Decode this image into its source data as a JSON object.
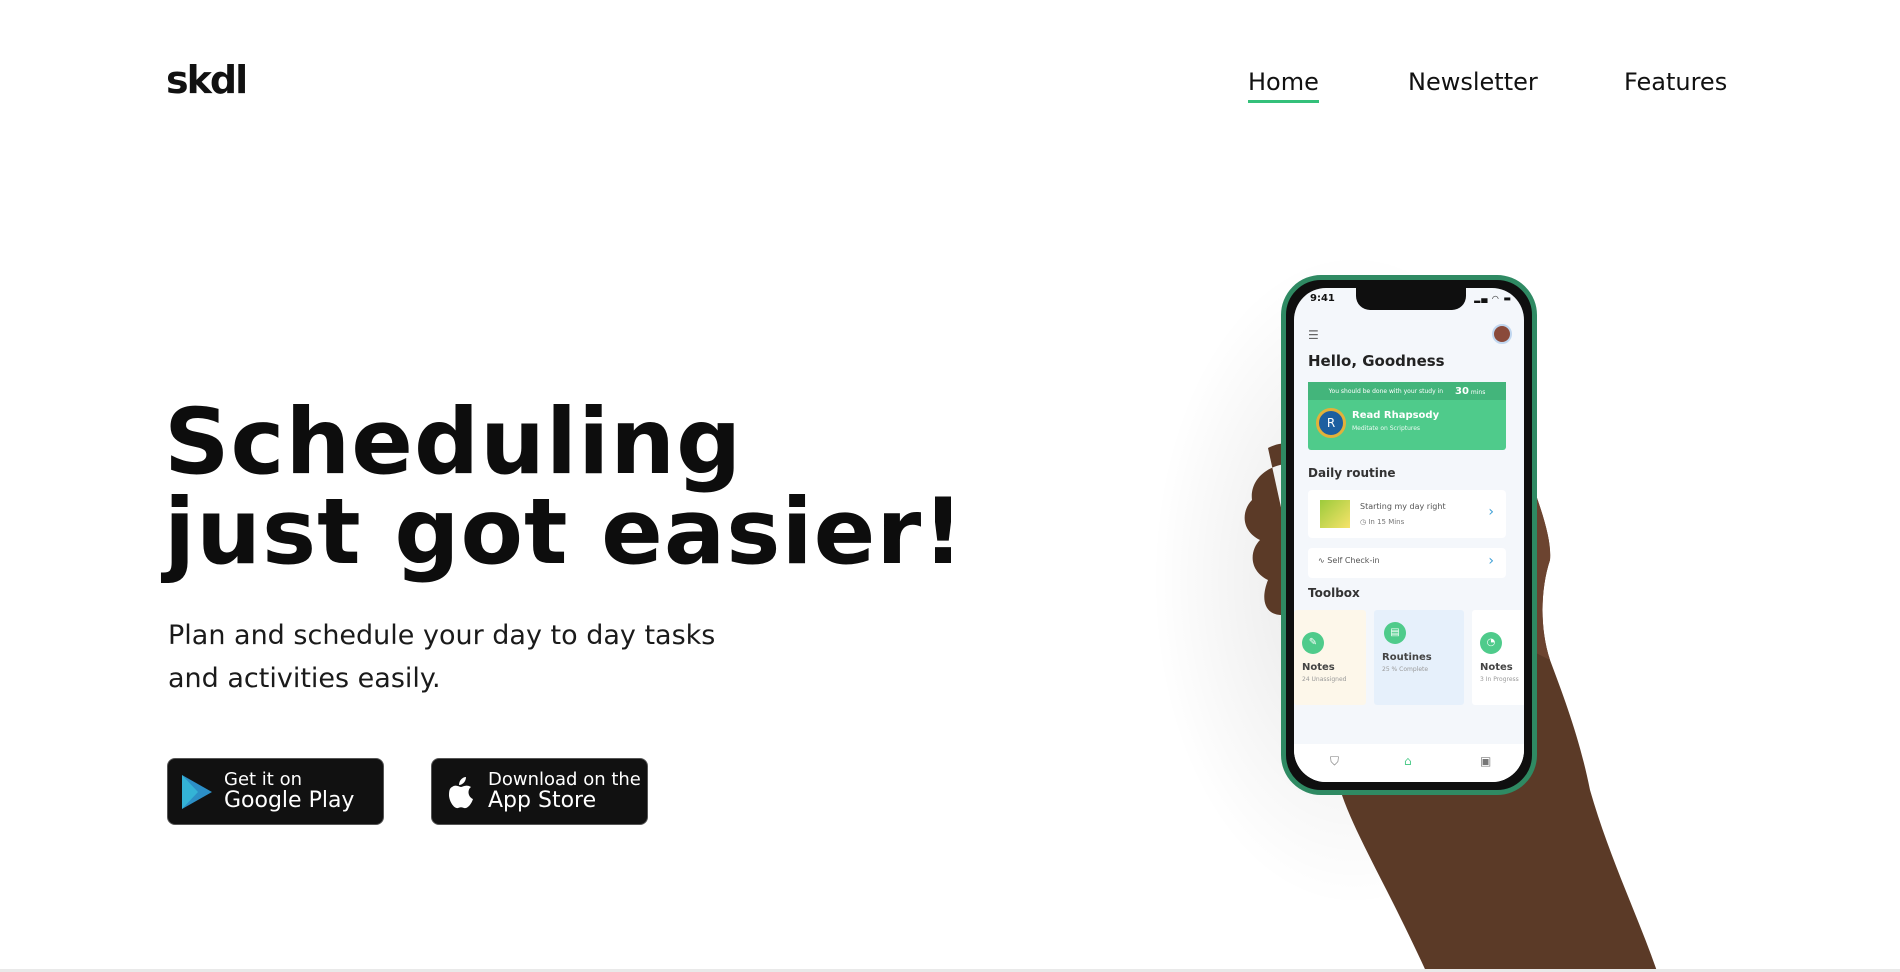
{
  "brand": {
    "logo": "skdl"
  },
  "nav": {
    "items": [
      "Home",
      "Newsletter",
      "Features"
    ],
    "active": "Home",
    "accent_color": "#34c07a"
  },
  "hero": {
    "title_line1": "Scheduling",
    "title_line2": "just got easier!",
    "subtitle": "Plan and schedule your day to day tasks and activities easily."
  },
  "buttons": {
    "google": {
      "top": "Get it on",
      "bottom": "Google Play",
      "icon": "google-play-icon"
    },
    "apple": {
      "top": "Download on the",
      "bottom": "App Store",
      "icon": "apple-icon"
    }
  },
  "phone": {
    "time": "9:41",
    "greeting": "Hello, Goodness",
    "focus": {
      "prefix": "You should be done with your study in",
      "minutes": "30",
      "minutes_unit": "mins",
      "title": "Read Rhapsody",
      "subtitle": "Meditate on Scriptures"
    },
    "daily_routine": {
      "heading": "Daily routine",
      "item_title": "Starting my day right",
      "item_time": "In 15 Mins"
    },
    "checkin": "Self Check-in",
    "toolbox": {
      "heading": "Toolbox",
      "tools": [
        {
          "name": "Notes",
          "meta": "24 Unassigned"
        },
        {
          "name": "Routines",
          "meta": "25 % Complete"
        },
        {
          "name": "Notes",
          "meta": "3 In Progress"
        }
      ]
    }
  }
}
